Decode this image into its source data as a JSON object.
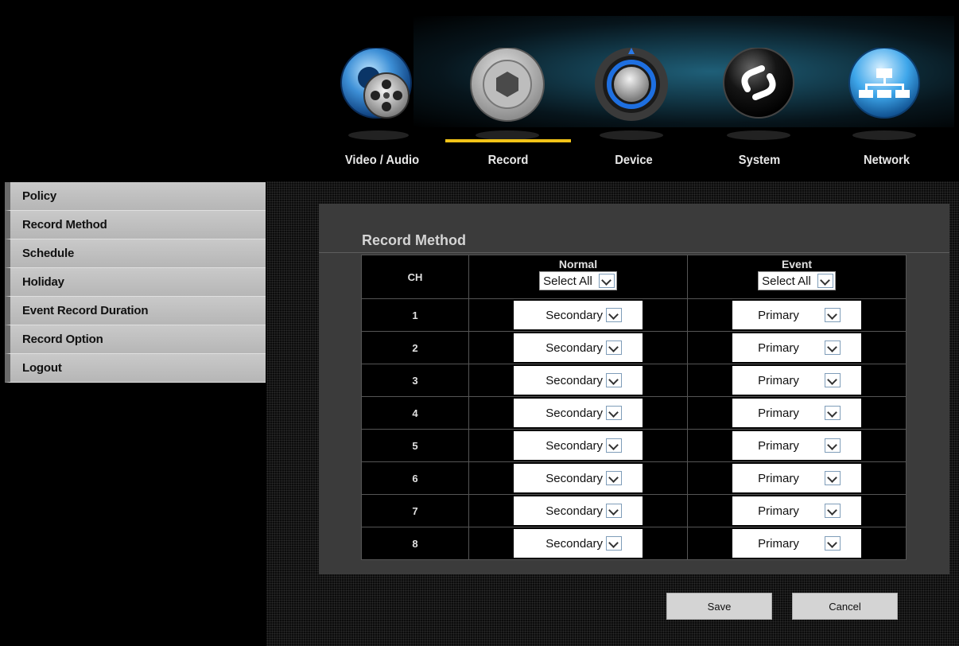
{
  "nav": {
    "items": [
      {
        "label": "Video / Audio",
        "icon": "video-audio-icon"
      },
      {
        "label": "Record",
        "icon": "record-icon"
      },
      {
        "label": "Device",
        "icon": "device-icon"
      },
      {
        "label": "System",
        "icon": "system-icon"
      },
      {
        "label": "Network",
        "icon": "network-icon"
      }
    ],
    "active": "Record",
    "active_color": "#f2c318"
  },
  "sidebar": {
    "items": [
      {
        "label": "Policy"
      },
      {
        "label": "Record Method"
      },
      {
        "label": "Schedule"
      },
      {
        "label": "Holiday"
      },
      {
        "label": "Event Record Duration"
      },
      {
        "label": "Record Option"
      },
      {
        "label": "Logout"
      }
    ]
  },
  "main": {
    "title": "Record Method",
    "columns": {
      "ch": "CH",
      "normal": "Normal",
      "event": "Event"
    },
    "select_all": {
      "normal": "Select All",
      "event": "Select All"
    },
    "rows": [
      {
        "ch": "1",
        "normal": "Secondary",
        "event": "Primary"
      },
      {
        "ch": "2",
        "normal": "Secondary",
        "event": "Primary"
      },
      {
        "ch": "3",
        "normal": "Secondary",
        "event": "Primary"
      },
      {
        "ch": "4",
        "normal": "Secondary",
        "event": "Primary"
      },
      {
        "ch": "5",
        "normal": "Secondary",
        "event": "Primary"
      },
      {
        "ch": "6",
        "normal": "Secondary",
        "event": "Primary"
      },
      {
        "ch": "7",
        "normal": "Secondary",
        "event": "Primary"
      },
      {
        "ch": "8",
        "normal": "Secondary",
        "event": "Primary"
      }
    ]
  },
  "buttons": {
    "save": "Save",
    "cancel": "Cancel"
  }
}
